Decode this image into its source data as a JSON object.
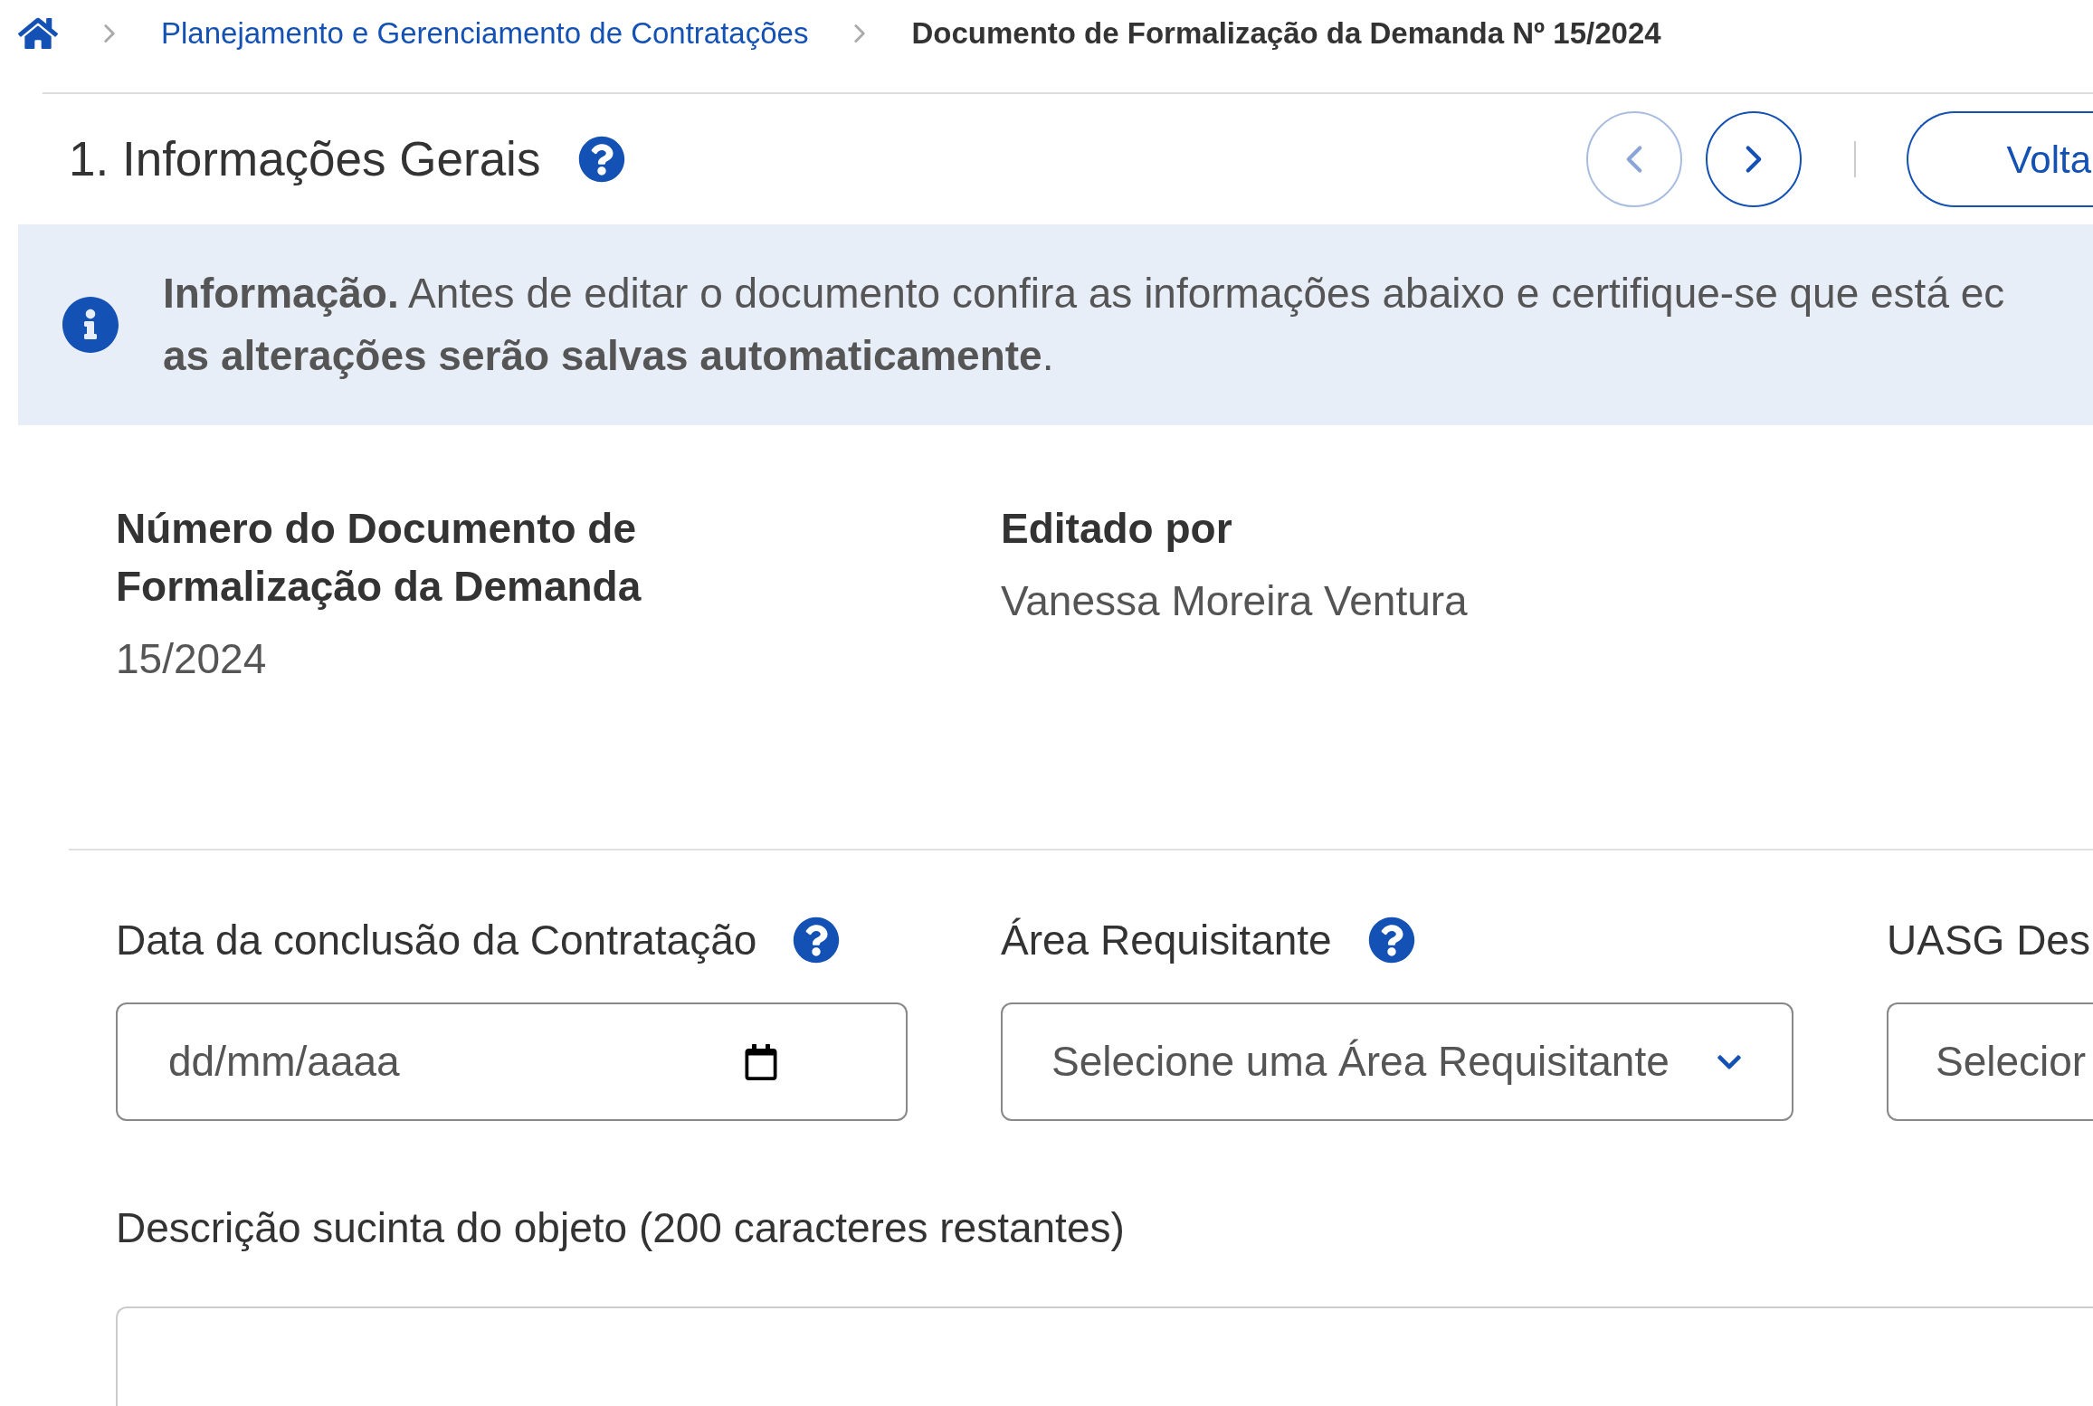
{
  "breadcrumb": {
    "items": [
      {
        "label": "Planejamento e Gerenciamento de Contratações",
        "kind": "link"
      },
      {
        "label": "Documento de Formalização da Demanda Nº 15/2024",
        "kind": "current"
      }
    ]
  },
  "section": {
    "title": "1. Informações Gerais",
    "nav": [
      {
        "kind": "prev",
        "disabled": true
      },
      {
        "kind": "next",
        "disabled": false
      }
    ],
    "back_button": "Volta"
  },
  "alert": {
    "text": "**Informação.** Antes de editar o documento confira as informações abaixo e certifique-se que está ec **as alterações serão salvas automaticamente**."
  },
  "info_fields": [
    {
      "label": "Número do Documento de Formalização da Demanda",
      "value": "15/2024"
    },
    {
      "label": "Editado por",
      "value": "Vanessa Moreira Ventura"
    }
  ],
  "form_fields": [
    {
      "label": "Data da conclusão da Contratação",
      "help": true,
      "kind": "date",
      "placeholder": "dd/mm/aaaa"
    },
    {
      "label": "Área Requisitante",
      "help": true,
      "kind": "select",
      "placeholder": "Selecione uma Área Requisitante"
    },
    {
      "label": "UASG Des",
      "kind": "select-cut",
      "placeholder": "Selecior"
    }
  ],
  "description": {
    "label": "Descrição sucinta do objeto (200 caracteres restantes)"
  }
}
